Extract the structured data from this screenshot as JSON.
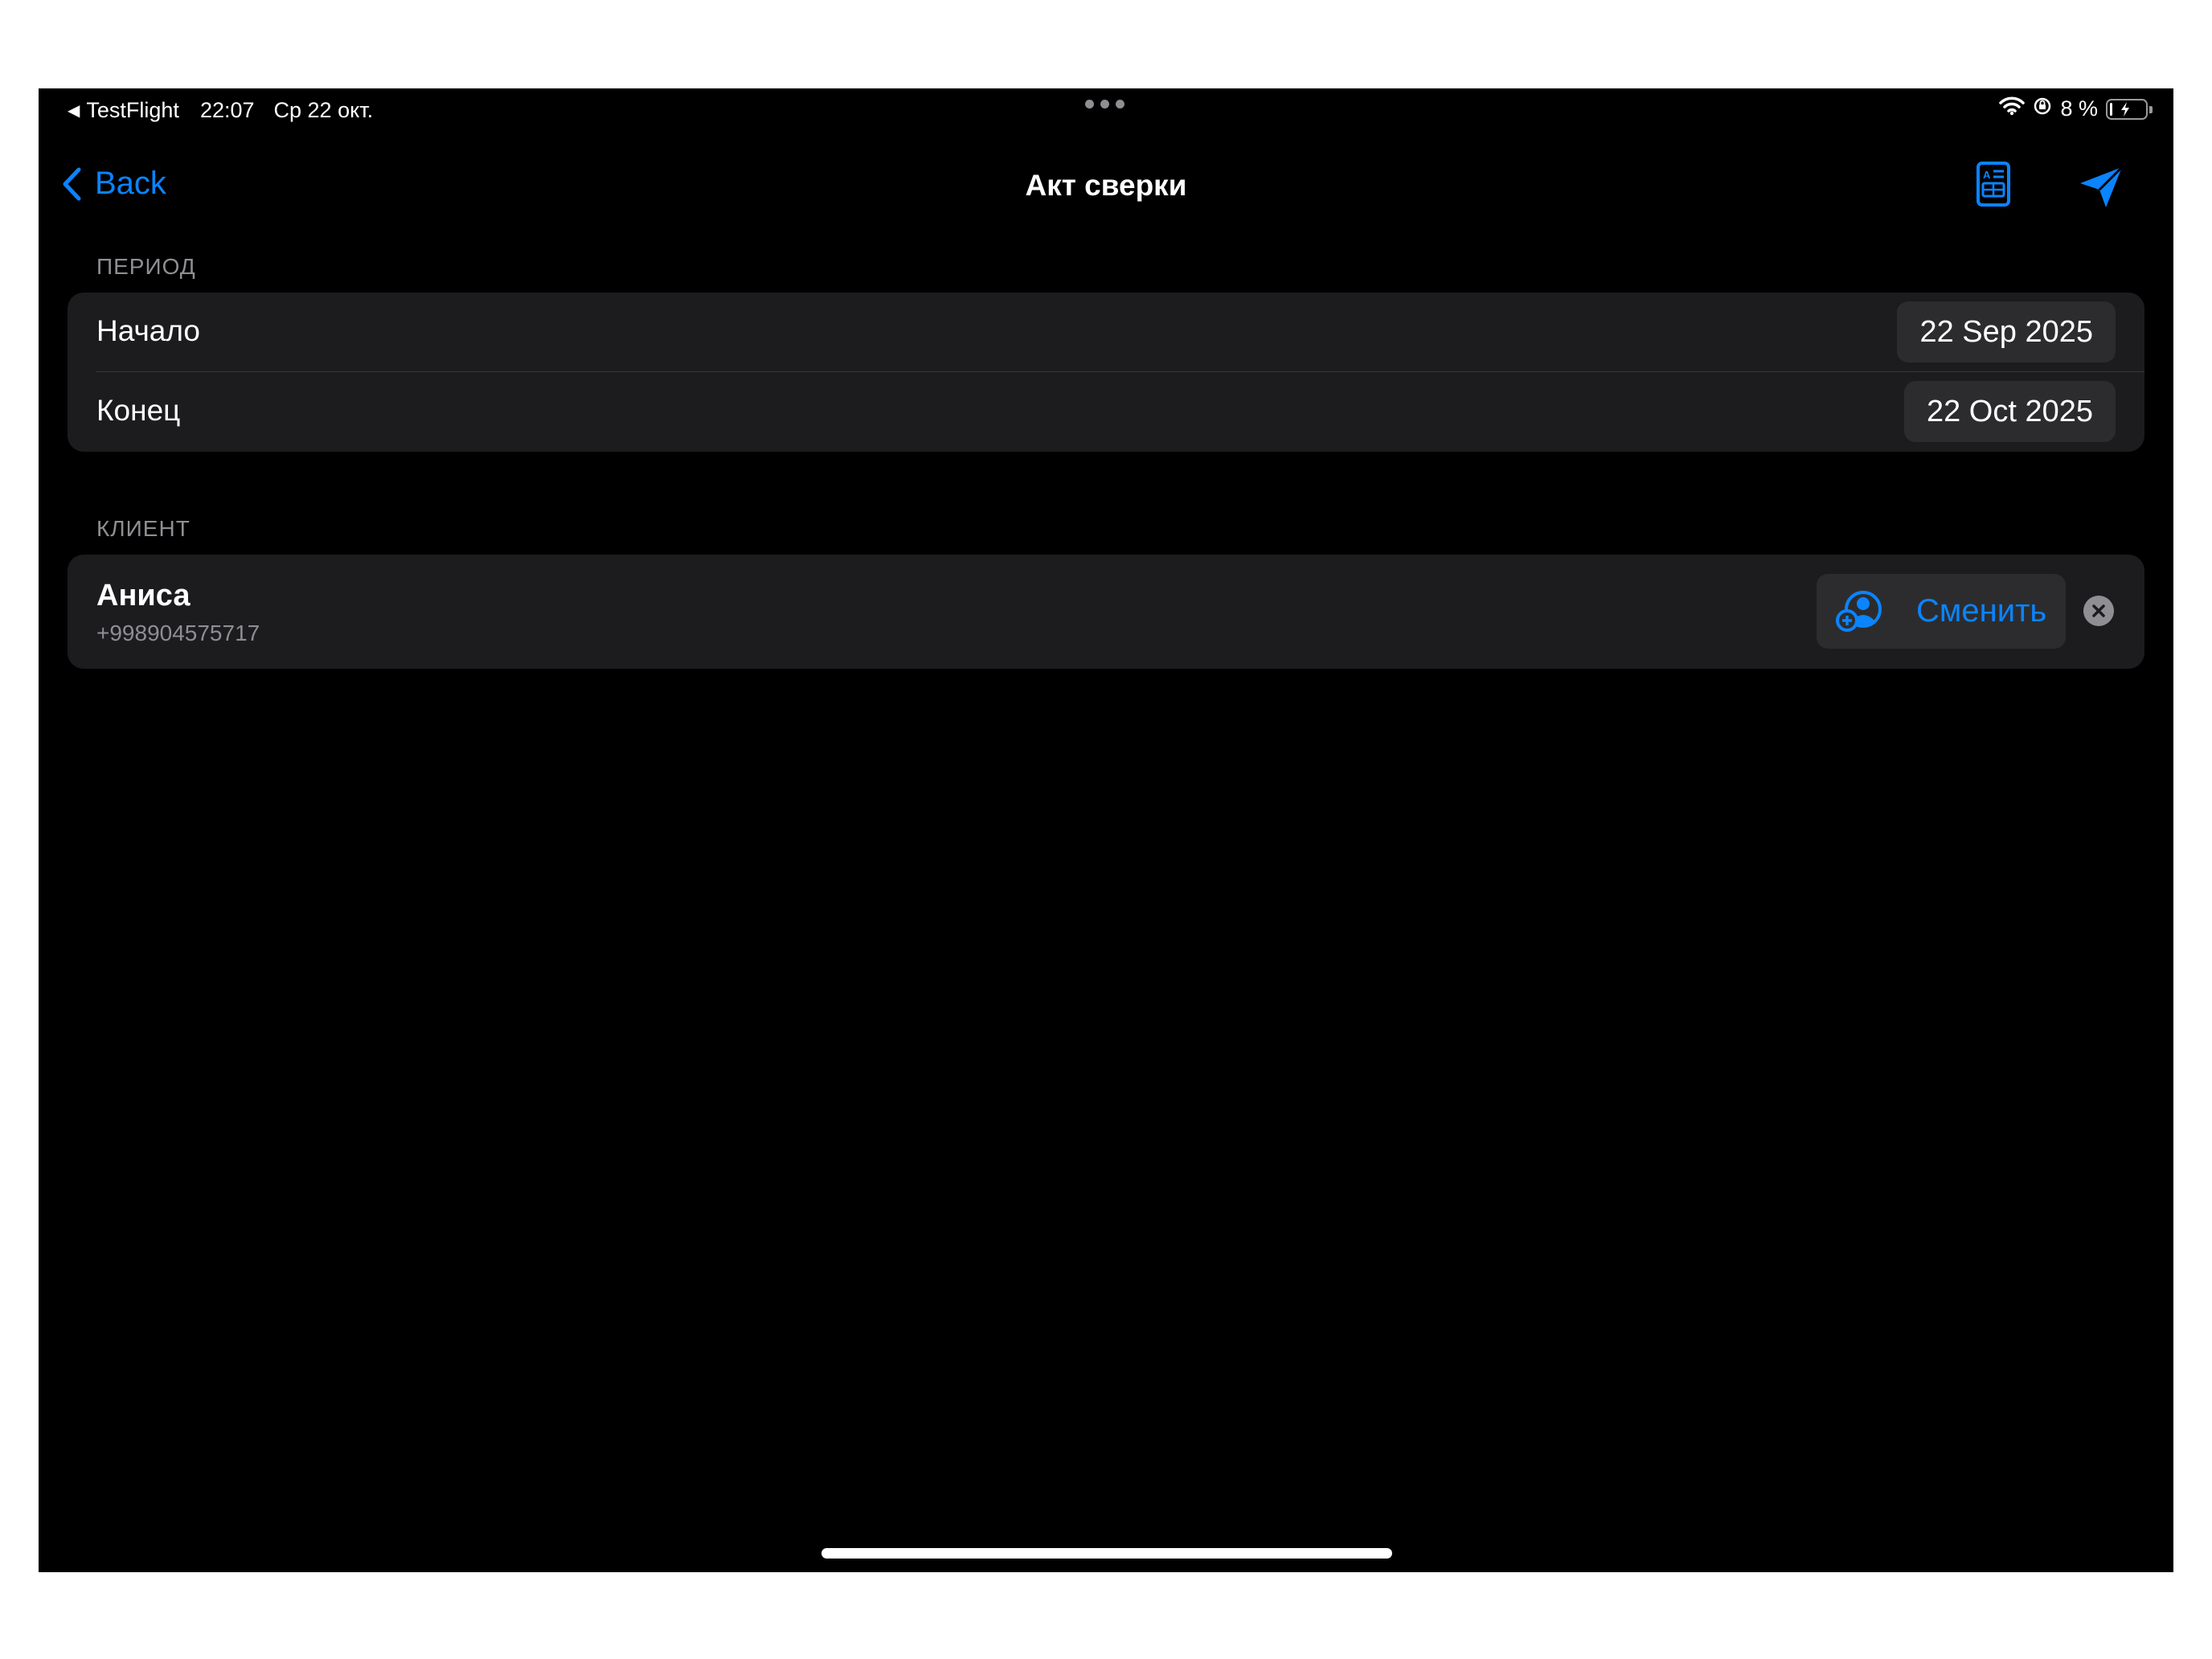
{
  "status_bar": {
    "back_app": "TestFlight",
    "time": "22:07",
    "date": "Ср 22 окт.",
    "battery_text": "8 %",
    "battery_level": 0.08,
    "icons": [
      "wifi-icon",
      "orientation-lock-icon",
      "battery-charging-icon"
    ]
  },
  "nav": {
    "back_label": "Back",
    "title": "Акт сверки",
    "icons": [
      "chevron-left-icon",
      "document-icon",
      "send-icon"
    ]
  },
  "period": {
    "header": "ПЕРИОД",
    "rows": [
      {
        "label": "Начало",
        "value": "22 Sep 2025"
      },
      {
        "label": "Конец",
        "value": "22 Oct 2025"
      }
    ]
  },
  "client": {
    "header": "КЛИЕНТ",
    "name": "Аниса",
    "phone": "+998904575717",
    "change_label": "Сменить",
    "icons": [
      "person-add-icon",
      "clear-icon"
    ]
  },
  "colors": {
    "background": "#000000",
    "card": "#1c1c1e",
    "button": "#2c2c2e",
    "accent": "#0a84ff",
    "secondary_text": "#8e8e93"
  }
}
